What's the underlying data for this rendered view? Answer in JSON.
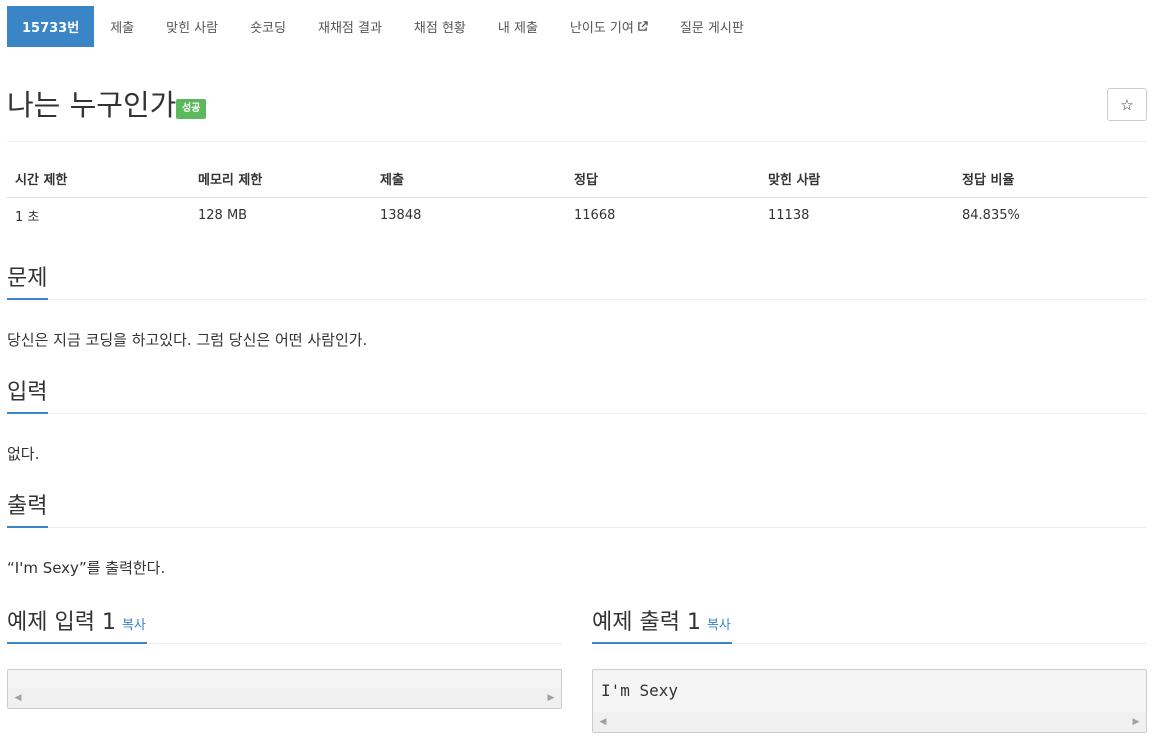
{
  "nav": {
    "items": [
      "15733번",
      "제출",
      "맞힌 사람",
      "숏코딩",
      "재채점 결과",
      "채점 현황",
      "내 제출",
      "난이도 기여",
      "질문 게시판"
    ]
  },
  "problem": {
    "title": "나는 누구인가",
    "badge": "성공",
    "star": "☆"
  },
  "info": {
    "headers": [
      "시간 제한",
      "메모리 제한",
      "제출",
      "정답",
      "맞힌 사람",
      "정답 비율"
    ],
    "values": [
      "1 초",
      "128 MB",
      "13848",
      "11668",
      "11138",
      "84.835%"
    ]
  },
  "sections": {
    "problem_title": "문제",
    "problem_text": "당신은 지금 코딩을 하고있다. 그럼 당신은 어떤 사람인가.",
    "input_title": "입력",
    "input_text": "없다.",
    "output_title": "출력",
    "output_text": "“I'm Sexy”를 출력한다."
  },
  "samples": {
    "input_title": "예제 입력 1",
    "input_copy": "복사",
    "input_value": "",
    "output_title": "예제 출력 1",
    "output_copy": "복사",
    "output_value": "I'm Sexy"
  },
  "colors": {
    "accent": "#3a85c6",
    "success": "#5cb85c"
  }
}
